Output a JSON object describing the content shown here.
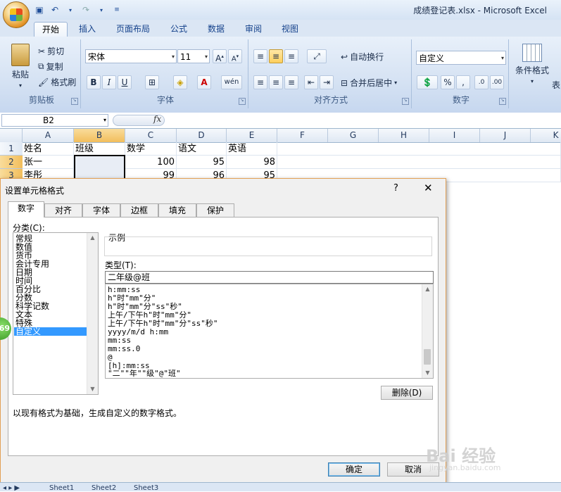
{
  "window": {
    "title": "成绩登记表.xlsx - Microsoft Excel"
  },
  "ribbon": {
    "tabs": [
      "开始",
      "插入",
      "页面布局",
      "公式",
      "数据",
      "审阅",
      "视图"
    ],
    "clipboard": {
      "paste": "粘贴",
      "cut": "剪切",
      "copy": "复制",
      "format_painter": "格式刷",
      "label": "剪贴板"
    },
    "font": {
      "name": "宋体",
      "size": "11",
      "bold": "B",
      "italic": "I",
      "underline": "U",
      "label": "字体"
    },
    "alignment": {
      "wrap": "自动换行",
      "merge": "合并后居中",
      "label": "对齐方式"
    },
    "number": {
      "format": "自定义",
      "percent": "%",
      "comma": ",",
      "label": "数字"
    },
    "styles": {
      "conditional": "条件格式",
      "table": "表"
    }
  },
  "formula_bar": {
    "name_box": "B2",
    "fx": "fx"
  },
  "sheet": {
    "columns": [
      "A",
      "B",
      "C",
      "D",
      "E",
      "F",
      "G",
      "H",
      "I",
      "J",
      "K"
    ],
    "rows": [
      "1",
      "2",
      "3"
    ],
    "cells": [
      [
        "姓名",
        "班级",
        "数学",
        "语文",
        "英语"
      ],
      [
        "张一",
        "",
        "100",
        "95",
        "98"
      ],
      [
        "李彤",
        "",
        "99",
        "96",
        "95"
      ]
    ]
  },
  "dialog": {
    "title": "设置单元格格式",
    "help": "?",
    "close": "✕",
    "tabs": [
      "数字",
      "对齐",
      "字体",
      "边框",
      "填充",
      "保护"
    ],
    "category_label": "分类(C):",
    "categories": [
      "常规",
      "数值",
      "货币",
      "会计专用",
      "日期",
      "时间",
      "百分比",
      "分数",
      "科学记数",
      "文本",
      "特殊",
      "自定义"
    ],
    "selected_category": "自定义",
    "sample_label": "示例",
    "type_label": "类型(T):",
    "type_value": "二年级@班",
    "formats": [
      "h:mm:ss",
      "h\"时\"mm\"分\"",
      "h\"时\"mm\"分\"ss\"秒\"",
      "上午/下午h\"时\"mm\"分\"",
      "上午/下午h\"时\"mm\"分\"ss\"秒\"",
      "yyyy/m/d h:mm",
      "mm:ss",
      "mm:ss.0",
      "@",
      "[h]:mm:ss",
      "\"二\"\"年\"\"级\"@\"班\""
    ],
    "delete_button": "删除(D)",
    "description": "以现有格式为基础，生成自定义的数字格式。",
    "ok": "确定",
    "cancel": "取消"
  },
  "badge": "69",
  "sheet_tabs": [
    "Sheet1",
    "Sheet2",
    "Sheet3"
  ],
  "watermark": {
    "main": "Bai 经验",
    "sub": "jingyan.baidu.com"
  }
}
